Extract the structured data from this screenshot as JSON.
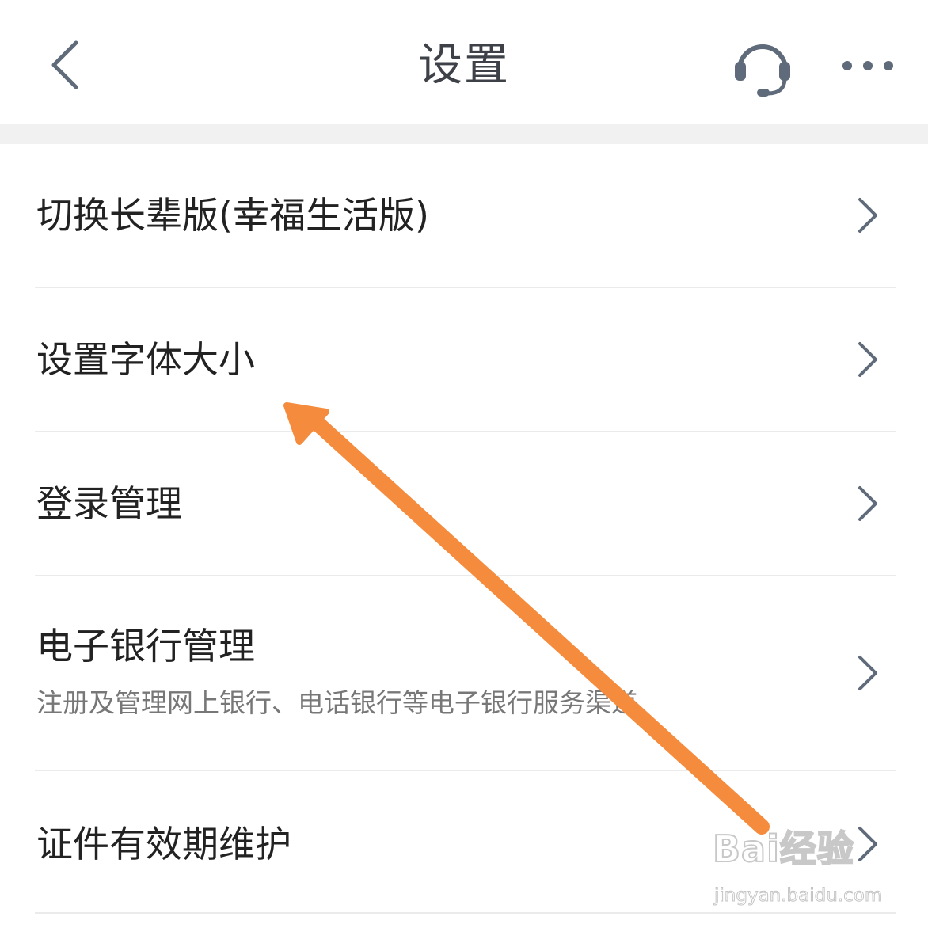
{
  "header": {
    "title": "设置",
    "back_icon": "chevron-left-icon",
    "support_icon": "headset-icon",
    "more_icon": "more-dots-icon",
    "icon_color": "#5f6b7a"
  },
  "settings": [
    {
      "label": "切换长辈版(幸福生活版)",
      "subtitle": ""
    },
    {
      "label": "设置字体大小",
      "subtitle": ""
    },
    {
      "label": "登录管理",
      "subtitle": ""
    },
    {
      "label": "电子银行管理",
      "subtitle": "注册及管理网上银行、电话银行等电子银行服务渠道"
    },
    {
      "label": "证件有效期维护",
      "subtitle": ""
    }
  ],
  "annotation": {
    "arrow_color": "#f58b3c"
  },
  "watermark": {
    "logo": "Bai经验",
    "url": "jingyan.baidu.com"
  }
}
